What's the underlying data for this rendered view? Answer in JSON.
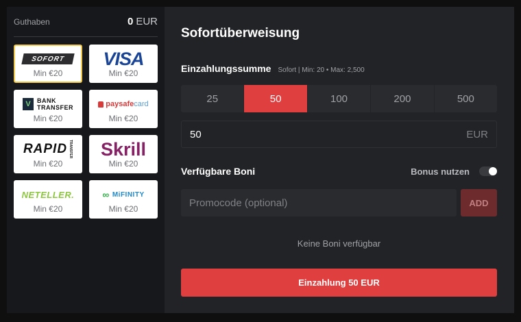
{
  "balance": {
    "label": "Guthaben",
    "amount": "0",
    "currency": "EUR"
  },
  "methods": [
    {
      "id": "sofort",
      "logo_text": "SOFORT",
      "min": "Min €20",
      "selected": true
    },
    {
      "id": "visa",
      "logo_text": "VISA",
      "min": "Min €20",
      "selected": false
    },
    {
      "id": "bank-transfer",
      "logo_badge": "V",
      "logo_line1": "BANK",
      "logo_line2": "TRANSFER",
      "min": "Min €20",
      "selected": false
    },
    {
      "id": "paysafecard",
      "logo_part1": "paysafe",
      "logo_part2": "card",
      "min": "Min €20",
      "selected": false
    },
    {
      "id": "rapid-transfer",
      "logo_text": "RAPID",
      "logo_sub": "TRANSFER",
      "min": "Min €20",
      "selected": false
    },
    {
      "id": "skrill",
      "logo_text": "Skrill",
      "min": "Min €20",
      "selected": false
    },
    {
      "id": "neteller",
      "logo_text": "NETELLER.",
      "min": "Min €20",
      "selected": false
    },
    {
      "id": "mifinity",
      "logo_symbol": "∞",
      "logo_text": "MiFINITY",
      "min": "Min €20",
      "selected": false
    }
  ],
  "main": {
    "title": "Sofortüberweisung",
    "amount_label": "Einzahlungssumme",
    "amount_hint": "Sofort | Min: 20 • Max: 2,500",
    "presets": [
      "25",
      "50",
      "100",
      "200",
      "500"
    ],
    "active_preset": "50",
    "amount_value": "50",
    "amount_currency": "EUR",
    "bonus_label": "Verfügbare Boni",
    "bonus_use_label": "Bonus nutzen",
    "bonus_toggle_on": true,
    "promo_placeholder": "Promocode (optional)",
    "add_label": "ADD",
    "no_bonus_text": "Keine Boni verfügbar",
    "submit_label": "Einzahlung 50 EUR"
  },
  "colors": {
    "accent": "#e03f3f",
    "selected_border": "#f2c94c",
    "panel_main": "#222326",
    "panel_side": "#17181b"
  }
}
